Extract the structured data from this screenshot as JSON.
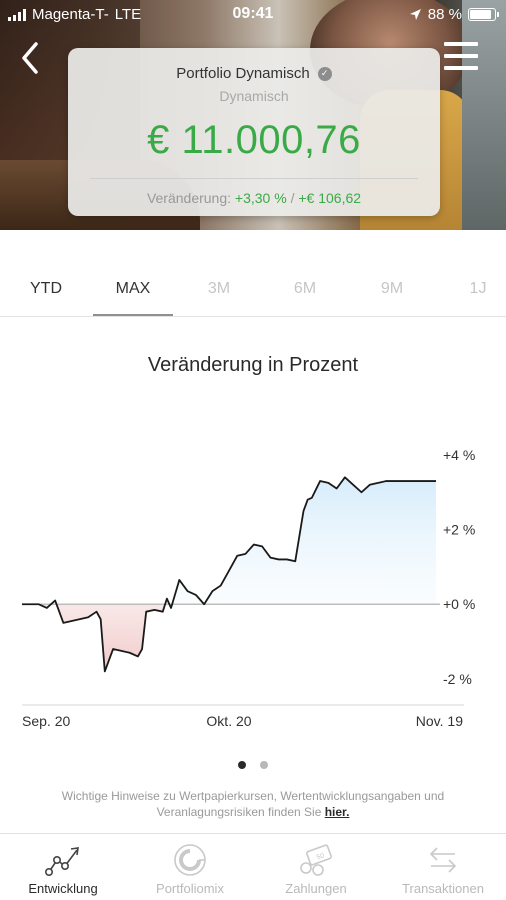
{
  "status_bar": {
    "carrier": "Magenta-T-",
    "network": "LTE",
    "time": "09:41",
    "battery": "88 %"
  },
  "portfolio": {
    "name": "Portfolio Dynamisch",
    "strategy": "Dynamisch",
    "value": "€ 11.000,76",
    "change_label": "Veränderung:",
    "change_percent": "+3,30 %",
    "change_separator": "/",
    "change_amount": "+€ 106,62"
  },
  "tabs": [
    {
      "label": "YTD"
    },
    {
      "label": "MAX"
    },
    {
      "label": "3M"
    },
    {
      "label": "6M"
    },
    {
      "label": "9M"
    },
    {
      "label": "1J"
    }
  ],
  "selected_tab": "MAX",
  "chart_title": "Veränderung in Prozent",
  "chart_data": {
    "type": "line",
    "title": "Veränderung in Prozent",
    "xlabel": "",
    "ylabel": "",
    "x_ticks": [
      "Sep. 20",
      "Okt. 20",
      "Nov. 19"
    ],
    "y_ticks": [
      "+4 %",
      "+2 %",
      "+0 %",
      "-2 %"
    ],
    "ylim": [
      -2.7,
      4.4
    ],
    "x": [
      0,
      2,
      4,
      6,
      8,
      10,
      12,
      14,
      16,
      18,
      19,
      20,
      22,
      24,
      26,
      28,
      29,
      30,
      32,
      34,
      35,
      36,
      38,
      40,
      42,
      44,
      46,
      48,
      50,
      52,
      54,
      56,
      58,
      60,
      62,
      64,
      66,
      68,
      69,
      70,
      72,
      74,
      76,
      78,
      80,
      82,
      84,
      86,
      88,
      90,
      92,
      94,
      96,
      98,
      100
    ],
    "series": [
      {
        "values": [
          0.0,
          0.0,
          0.0,
          -0.1,
          0.1,
          -0.5,
          -0.45,
          -0.4,
          -0.35,
          -0.2,
          -0.4,
          -1.8,
          -1.2,
          -1.25,
          -1.3,
          -1.4,
          -1.2,
          -0.2,
          -0.15,
          -0.2,
          0.15,
          -0.1,
          0.65,
          0.35,
          0.25,
          0.0,
          0.35,
          0.5,
          0.9,
          1.3,
          1.35,
          1.6,
          1.55,
          1.25,
          1.2,
          1.2,
          1.15,
          2.5,
          2.8,
          2.85,
          3.3,
          3.25,
          3.1,
          3.4,
          3.2,
          3.0,
          3.2,
          3.25,
          3.3,
          3.3,
          3.3,
          3.3,
          3.3,
          3.3,
          3.3
        ]
      }
    ],
    "grid": false,
    "baseline": 0,
    "fill_above": "#d6ecfb",
    "fill_below": "#f1c9c9",
    "line_color": "#1a1a1a"
  },
  "pager": {
    "count": 2,
    "active": 0
  },
  "notice": {
    "text": "Wichtige Hinweise zu Wertpapierkursen, Wertentwicklungsangaben und Veranlagungsrisiken finden Sie",
    "link": "hier."
  },
  "bottom_nav": [
    {
      "label": "Entwicklung",
      "icon": "trend-line-icon",
      "active": true
    },
    {
      "label": "Portfoliomix",
      "icon": "pie-circle-icon",
      "active": false
    },
    {
      "label": "Zahlungen",
      "icon": "banknote-coins-icon",
      "active": false
    },
    {
      "label": "Transaktionen",
      "icon": "transfer-arrows-icon",
      "active": false
    }
  ]
}
